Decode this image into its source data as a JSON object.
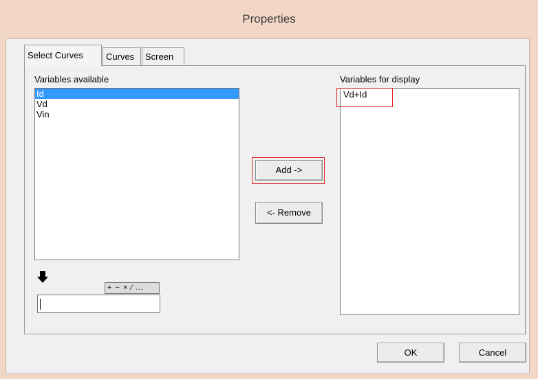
{
  "window": {
    "title": "Properties"
  },
  "tabs": [
    {
      "label": "Select Curves",
      "active": true
    },
    {
      "label": "Curves",
      "active": false
    },
    {
      "label": "Screen",
      "active": false
    }
  ],
  "available": {
    "label": "Variables available",
    "items": [
      "Id",
      "Vd",
      "Vin"
    ],
    "selected_index": 0
  },
  "display": {
    "label": "Variables for display",
    "items": [
      "Vd+Id"
    ]
  },
  "buttons": {
    "add": "Add ->",
    "remove": "<- Remove",
    "ok": "OK",
    "cancel": "Cancel"
  },
  "expression": {
    "operators": "+ − × ⁄ ...",
    "value": ""
  },
  "colors": {
    "highlight": "#e0242a",
    "selection": "#3399ff"
  },
  "icons": {
    "insert": "down-arrow-icon"
  }
}
